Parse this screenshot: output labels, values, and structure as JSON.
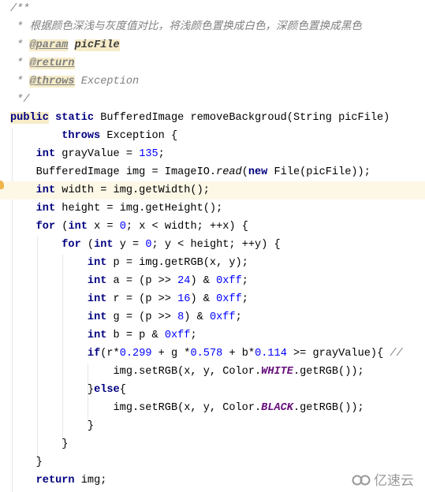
{
  "editor": {
    "current_line": 10,
    "lines": [
      [
        [
          "/**",
          "cm"
        ]
      ],
      [
        [
          " * 根据颜色深浅与灰度值对比，将浅颜色置换成白色，深颜色置换成黑色",
          "cm"
        ]
      ],
      [
        [
          " * ",
          "cm"
        ],
        [
          "@param",
          "tag"
        ],
        [
          " ",
          "cm"
        ],
        [
          "picFile",
          "prm"
        ]
      ],
      [
        [
          " * ",
          "cm"
        ],
        [
          "@return",
          "tag"
        ]
      ],
      [
        [
          " * ",
          "cm"
        ],
        [
          "@throws",
          "tag"
        ],
        [
          " Exception",
          "cm"
        ]
      ],
      [
        [
          " */",
          "cm"
        ]
      ],
      [
        [
          "public",
          "kw pub"
        ],
        [
          " "
        ],
        [
          "static",
          "kw"
        ],
        [
          " BufferedImage removeBackgroud(String picFile)"
        ]
      ],
      [
        [
          "        "
        ],
        [
          "throws",
          "kw"
        ],
        [
          " Exception {"
        ]
      ],
      [
        [
          "    "
        ],
        [
          "int",
          "kw"
        ],
        [
          " grayValue = "
        ],
        [
          "135",
          "num"
        ],
        [
          ";"
        ]
      ],
      [
        [
          "    BufferedImage img = ImageIO."
        ],
        [
          "read",
          "sm"
        ],
        [
          "("
        ],
        [
          "new",
          "kw"
        ],
        [
          " File(picFile));"
        ]
      ],
      [
        [
          "    "
        ],
        [
          "int",
          "kw"
        ],
        [
          " width = img.getWidth();"
        ]
      ],
      [
        [
          "    "
        ],
        [
          "int",
          "kw"
        ],
        [
          " height = img.getHeight();"
        ]
      ],
      [
        [
          "    "
        ],
        [
          "for",
          "kw"
        ],
        [
          " ("
        ],
        [
          "int",
          "kw"
        ],
        [
          " x = "
        ],
        [
          "0",
          "num"
        ],
        [
          "; x < width; ++x) {"
        ]
      ],
      [
        [
          "        "
        ],
        [
          "for",
          "kw"
        ],
        [
          " ("
        ],
        [
          "int",
          "kw"
        ],
        [
          " y = "
        ],
        [
          "0",
          "num"
        ],
        [
          "; y < height; ++y) {"
        ]
      ],
      [
        [
          "            "
        ],
        [
          "int",
          "kw"
        ],
        [
          " p = img.getRGB(x, y);"
        ]
      ],
      [
        [
          "            "
        ],
        [
          "int",
          "kw"
        ],
        [
          " a = (p >> "
        ],
        [
          "24",
          "num"
        ],
        [
          ") & "
        ],
        [
          "0xff",
          "num"
        ],
        [
          ";"
        ]
      ],
      [
        [
          "            "
        ],
        [
          "int",
          "kw"
        ],
        [
          " r = (p >> "
        ],
        [
          "16",
          "num"
        ],
        [
          ") & "
        ],
        [
          "0xff",
          "num"
        ],
        [
          ";"
        ]
      ],
      [
        [
          "            "
        ],
        [
          "int",
          "kw"
        ],
        [
          " g = (p >> "
        ],
        [
          "8",
          "num"
        ],
        [
          ") & "
        ],
        [
          "0xff",
          "num"
        ],
        [
          ";"
        ]
      ],
      [
        [
          "            "
        ],
        [
          "int",
          "kw"
        ],
        [
          " b = p & "
        ],
        [
          "0xff",
          "num"
        ],
        [
          ";"
        ]
      ],
      [
        [
          "            "
        ],
        [
          "if",
          "kw"
        ],
        [
          "(r*"
        ],
        [
          "0.299",
          "num"
        ],
        [
          " + g *"
        ],
        [
          "0.578",
          "num"
        ],
        [
          " + b*"
        ],
        [
          "0.114",
          "num"
        ],
        [
          " >= grayValue){ "
        ],
        [
          "//",
          "cm"
        ]
      ],
      [
        [
          "                img.setRGB(x, y, Color."
        ],
        [
          "WHITE",
          "fld"
        ],
        [
          ".getRGB());"
        ]
      ],
      [
        [
          "            }"
        ],
        [
          "else",
          "kw"
        ],
        [
          "{"
        ]
      ],
      [
        [
          "                img.setRGB(x, y, Color."
        ],
        [
          "BLACK",
          "fld"
        ],
        [
          ".getRGB());"
        ]
      ],
      [
        [
          "            }"
        ]
      ],
      [
        [
          "        }"
        ]
      ],
      [
        [
          "    }"
        ]
      ],
      [
        [
          "    "
        ],
        [
          "return",
          "kw"
        ],
        [
          " img;"
        ]
      ]
    ]
  },
  "watermark": {
    "text": "亿速云",
    "icon": "cloud-logo-icon"
  },
  "colors": {
    "keyword": "#000080",
    "number": "#0000ff",
    "comment": "#808080",
    "field": "#660e7a",
    "current_line": "#fdf8e6"
  }
}
